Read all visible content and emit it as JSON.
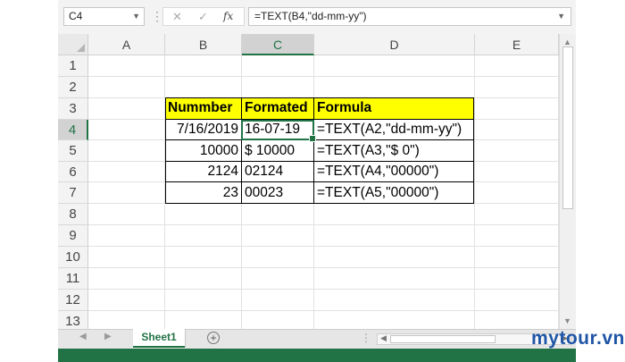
{
  "formula_bar": {
    "name_box": "C4",
    "cancel_icon": "close-icon",
    "enter_icon": "check-icon",
    "function_label": "fx",
    "formula": "=TEXT(B4,\"dd-mm-yy\")"
  },
  "sheet": {
    "columns": [
      "A",
      "B",
      "C",
      "D",
      "E"
    ],
    "rows": [
      "1",
      "2",
      "3",
      "4",
      "5",
      "6",
      "7",
      "8",
      "9",
      "10",
      "11",
      "12",
      "13"
    ],
    "selected_column": "C",
    "selected_row": "4",
    "active_cell": "C4",
    "table": {
      "header_fill": "#ffff00",
      "headers": [
        "Nummber",
        "Formated",
        "Formula"
      ],
      "rows": [
        [
          "7/16/2019",
          "16-07-19",
          "=TEXT(A2,\"dd-mm-yy\")"
        ],
        [
          "10000",
          "$ 10000",
          "=TEXT(A3,\"$ 0\")"
        ],
        [
          "2124",
          "02124",
          "=TEXT(A4,\"00000\")"
        ],
        [
          "23",
          "00023",
          "=TEXT(A5,\"00000\")"
        ]
      ]
    }
  },
  "tabs": {
    "sheets": [
      "Sheet1"
    ],
    "active": "Sheet1",
    "add_label": "+"
  },
  "accent_color": "#217346",
  "watermark": {
    "text": "mytour.vn",
    "color": "#1f55a6"
  }
}
